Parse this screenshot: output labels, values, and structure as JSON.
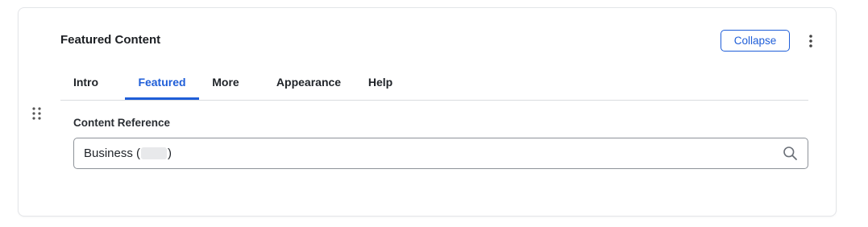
{
  "block": {
    "title": "Featured Content",
    "collapse_label": "Collapse",
    "menu_icon": "kebab-vertical-icon",
    "drag_icon": "drag-grip-icon"
  },
  "tabs": [
    {
      "label": "Intro",
      "active": false
    },
    {
      "label": "Featured",
      "active": true
    },
    {
      "label": "More",
      "active": false
    },
    {
      "label": "Appearance",
      "active": false
    },
    {
      "label": "Help",
      "active": false
    }
  ],
  "field": {
    "label": "Content Reference",
    "value_prefix": "Business (",
    "value_suffix": ")",
    "search_icon": "search-icon"
  },
  "colors": {
    "accent": "#1f5ed8",
    "border": "#e3e5e8",
    "text": "#1f2328"
  }
}
